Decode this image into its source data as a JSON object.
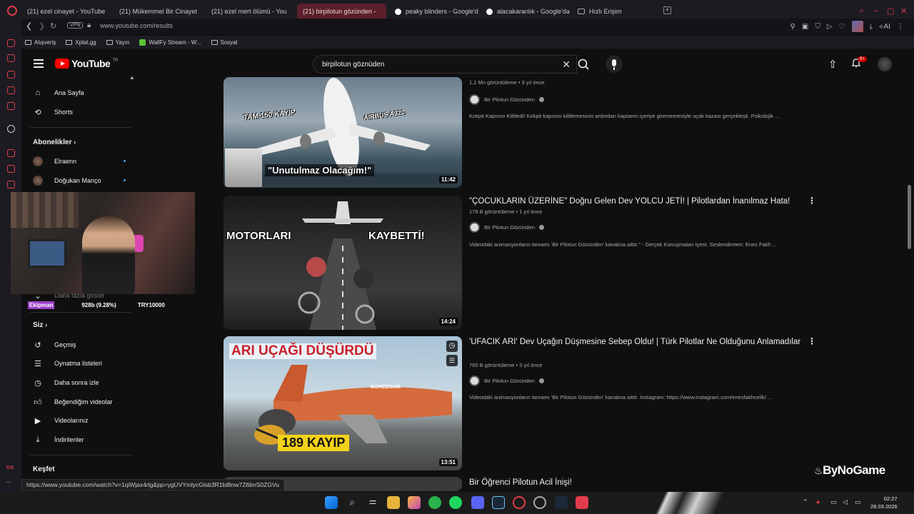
{
  "browser": {
    "tabs": [
      {
        "label": "(21) ezel cinayet - YouTube",
        "icon": "youtube-icon",
        "active": false
      },
      {
        "label": "(21) Mükemmel Bir Cinayet",
        "icon": "youtube-icon",
        "active": false
      },
      {
        "label": "(21) ezel mert ölümü - You",
        "icon": "youtube-icon",
        "active": false
      },
      {
        "label": "(21) birpilotun gözünden -",
        "icon": "youtube-icon",
        "active": true
      },
      {
        "label": "peaky blinders - Google'd",
        "icon": "google-icon",
        "active": false
      },
      {
        "label": "alacakaranlık - Google'da",
        "icon": "google-icon",
        "active": false
      },
      {
        "label": "Hızlı Erişim",
        "icon": "grid-icon",
        "active": false
      }
    ],
    "vpn_label": "VPN",
    "url": "www.youtube.com/results",
    "ai_label": "AI",
    "bookmarks": [
      "Alışveriş",
      "Xplat.gg",
      "Yayın",
      "WallFy Stream - W...",
      "Sosyal"
    ],
    "opera_gx_label": "GX",
    "status_url": "https://www.youtube.com/watch?v=1qiWjax4rlg&pp=ygUVYmlycGlsb3R1biBnw7Z6bnS0ZGVu"
  },
  "youtube": {
    "logo": "YouTube",
    "region": "TR",
    "search_query": "birpilotun göznüden",
    "notification_count": "9+",
    "sidebar": {
      "main": [
        {
          "label": "Ana Sayfa",
          "icon": "home-icon"
        },
        {
          "label": "Shorts",
          "icon": "shorts-icon"
        }
      ],
      "subscriptions_heading": "Abonelikler",
      "subscriptions": [
        {
          "label": "Elraenn"
        },
        {
          "label": "Doğukan Manço"
        }
      ],
      "show_more": "Daha fazla göster",
      "you_heading": "Siz",
      "you_items": [
        {
          "label": "Geçmiş",
          "icon": "history-icon"
        },
        {
          "label": "Oynatma listeleri",
          "icon": "playlist-icon"
        },
        {
          "label": "Daha sonra izle",
          "icon": "clock-icon"
        },
        {
          "label": "Beğendiğim videolar",
          "icon": "like-icon"
        },
        {
          "label": "Videolarınız",
          "icon": "video-icon"
        },
        {
          "label": "İndirilenler",
          "icon": "download-icon"
        }
      ],
      "explore_heading": "Keşfet"
    },
    "results": [
      {
        "title": "",
        "views": "1,1 Mn görüntüleme • 3 yıl önce",
        "channel": "Bir Pilotun Gözünden",
        "description": "Kokpit Kapısını Kilitledi! Kokpit kapısını kilitlemesinin ardından kaptanın içeriye girememesiyle uçak kazası gerçekleşti. Psikolojik ...",
        "duration": "11:42",
        "thumb_text": [
          "TAM 150 KAYIP",
          "AIRBUS A320",
          "\"Unutulmaz Olacağım!\""
        ]
      },
      {
        "title": "\"ÇOCUKLARIN ÜZERİNE\" Doğru Gelen Dev YOLCU JETİ! | Pilotlardan İnanılmaz Hata!",
        "views": "178 B görüntüleme • 1 yıl önce",
        "channel": "Bir Pilotun Gözünden",
        "description": "Videodaki animasyonların tamamı 'Bir Pilotun Gözünden' kanalına aittir.\" - Gerçek Konuşmaları içerir. Seslendirmen: Enes Fatih ...",
        "duration": "14:24",
        "thumb_text": [
          "MOTORLARI",
          "KAYBETTİ!"
        ]
      },
      {
        "title": "'UFACIK ARI' Dev Uçağın Düşmesine Sebep Oldu! | Türk Pilotlar Ne Olduğunu Anlamadılar",
        "views": "760 B görüntüleme • 3 yıl önce",
        "channel": "Bir Pilotun Gözünden",
        "description": "Videodaki animasyonların tamamı 'Bir Pilotun Gözünden' kanalına aittir. Instagram: https://www.instagram.com/enesfatihcelik/ ...",
        "duration": "13:51",
        "thumb_text": [
          "ARI UÇAĞI DÜŞÜRDÜ",
          "189 KAYIP",
          "BOREENAIR"
        ]
      },
      {
        "title": "Bir Öğrenci Pilotun Acil İnişi!"
      }
    ]
  },
  "stream_overlay": {
    "donor": "Ekipman",
    "amount": "928b (9.28%)",
    "goal": "TRY10000",
    "watermark": "ByNoGame"
  },
  "taskbar": {
    "time": "02:27",
    "date": "28.03.2026",
    "colors": {
      "accent": "#e23c4a",
      "youtube_red": "#ff0000",
      "active_tab": "#5a1f2a"
    }
  }
}
